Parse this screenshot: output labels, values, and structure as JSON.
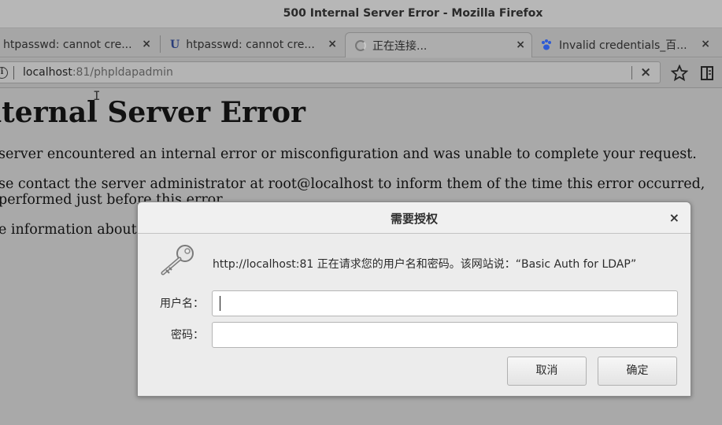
{
  "window": {
    "title": "500 Internal Server Error - Mozilla Firefox"
  },
  "tabs": [
    {
      "label": "htpasswd: cannot cre...",
      "close": "×"
    },
    {
      "label": "htpasswd: cannot cre...",
      "favicon": "U",
      "close": "×"
    },
    {
      "label": "正在连接...",
      "close": "×",
      "active": true
    },
    {
      "label": "Invalid credentials_百...",
      "close": "×"
    }
  ],
  "address_bar": {
    "host": "localhost",
    "rest": ":81/phpldapadmin",
    "clear": "×"
  },
  "page": {
    "heading": "nternal Server Error",
    "para1": "server encountered an internal error or misconfiguration and was unable to complete your request.",
    "para2_line1": "se contact the server administrator at root@localhost to inform them of the time this error occurred, ",
    "para2_line2": "performed just before this error.",
    "para3": "e information about"
  },
  "dialog": {
    "title": "需要授权",
    "close": "×",
    "message": "http://localhost:81 正在请求您的用户名和密码。该网站说：“Basic Auth for LDAP”",
    "username_label": "用户名：",
    "password_label": "密码：",
    "username_value": "",
    "password_value": "",
    "cancel_label": "取消",
    "ok_label": "确定"
  },
  "colors": {
    "overlay": "#a9a9a9",
    "dialog_bg": "#ececec"
  }
}
